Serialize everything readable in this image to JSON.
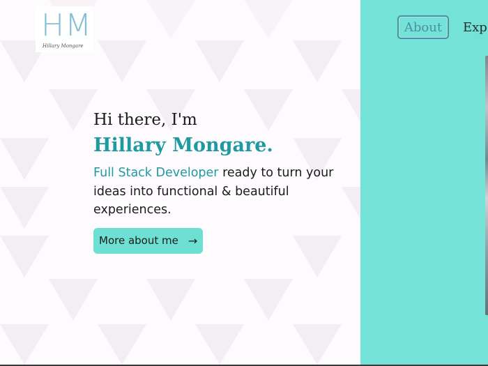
{
  "logo": {
    "mark": "HM",
    "signature": "Hillary Mongare"
  },
  "nav": {
    "items": [
      {
        "label": "About",
        "active": true
      },
      {
        "label": "Exp"
      }
    ]
  },
  "hero": {
    "greeting": "Hi there, I'm",
    "name": "Hillary Mongare.",
    "role": "Full Stack Developer",
    "tagline_rest": " ready to turn your ideas into functional & beautiful experiences.",
    "cta_label": "More about me",
    "cta_icon": "arrow-right-icon"
  },
  "colors": {
    "accent": "#1f9aa0",
    "teal_panel": "#74e2d6",
    "button_bg": "#6ee0d3",
    "logo": "#84bfd6"
  }
}
